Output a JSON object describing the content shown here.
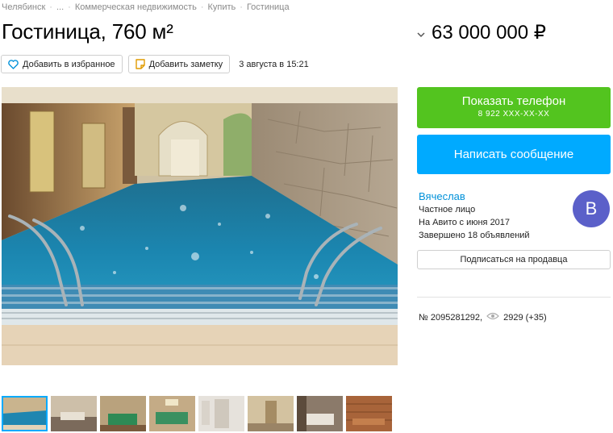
{
  "breadcrumb": {
    "items": [
      "Челябинск",
      "...",
      "Коммерческая недвижимость",
      "Купить",
      "Гостиница"
    ],
    "separator": "·"
  },
  "listing": {
    "title": "Гостиница, 760 м²",
    "price": "63 000 000 ₽",
    "date": "3 августа в 15:21",
    "number": "№ 2095281292,",
    "views": "2929 (+35)"
  },
  "actions": {
    "favorite_label": "Добавить в избранное",
    "note_label": "Добавить заметку"
  },
  "contact": {
    "show_phone_label": "Показать телефон",
    "phone_masked": "8 922 XXX-XX-XX",
    "message_label": "Написать сообщение",
    "subscribe_label": "Подписаться на продавца"
  },
  "seller": {
    "name": "Вячеслав",
    "type": "Частное лицо",
    "since": "На Авито с июня 2017",
    "completed": "Завершено 18 объявлений",
    "avatar_letter": "В"
  },
  "colors": {
    "green": "#53c41f",
    "blue": "#00aaff",
    "link": "#0091d9",
    "avatar": "#5b60c9"
  },
  "thumbnails": {
    "count": 8,
    "active_index": 0,
    "scenes": [
      "pool",
      "lounge",
      "billiards",
      "billiards",
      "bathroom",
      "hall",
      "bedroom",
      "sauna"
    ]
  }
}
